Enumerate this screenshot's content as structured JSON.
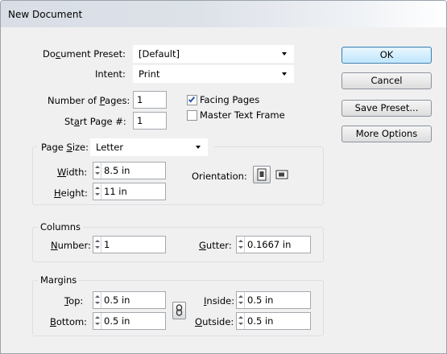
{
  "window": {
    "title": "New Document"
  },
  "preset": {
    "label_pre": "Do",
    "label_mn": "c",
    "label_post": "ument Preset:",
    "value": "[Default]"
  },
  "intent": {
    "label": "Intent:",
    "value": "Print"
  },
  "pages": {
    "number_label_pre": "Number of ",
    "number_label_mn": "P",
    "number_label_post": "ages:",
    "number_value": "1",
    "start_label_pre": "St",
    "start_label_mn": "a",
    "start_label_post": "rt Page #:",
    "start_value": "1"
  },
  "facing_pages": {
    "label": "Facing Pages",
    "checked": true
  },
  "master_text_frame": {
    "label": "Master Text Frame",
    "checked": false
  },
  "page_size": {
    "label_pre": "Page ",
    "label_mn": "S",
    "label_post": "ize:",
    "value": "Letter",
    "width_label_mn": "W",
    "width_label_post": "idth:",
    "width_value": "8.5 in",
    "height_label_mn": "H",
    "height_label_post": "eight:",
    "height_value": "11 in",
    "orientation_label": "Orientation:"
  },
  "columns": {
    "legend": "Columns",
    "number_label_mn": "N",
    "number_label_post": "umber:",
    "number_value": "1",
    "gutter_label_mn": "G",
    "gutter_label_post": "utter:",
    "gutter_value": "0.1667 in"
  },
  "margins": {
    "legend": "Margins",
    "top_label_mn": "T",
    "top_label_post": "op:",
    "top_value": "0.5 in",
    "bottom_label_mn": "B",
    "bottom_label_post": "ottom:",
    "bottom_value": "0.5 in",
    "inside_label_mn": "I",
    "inside_label_post": "nside:",
    "inside_value": "0.5 in",
    "outside_label_mn": "O",
    "outside_label_post": "utside:",
    "outside_value": "0.5 in"
  },
  "buttons": {
    "ok": "OK",
    "cancel": "Cancel",
    "save_preset": "Save Preset...",
    "more_options": "More Options"
  }
}
